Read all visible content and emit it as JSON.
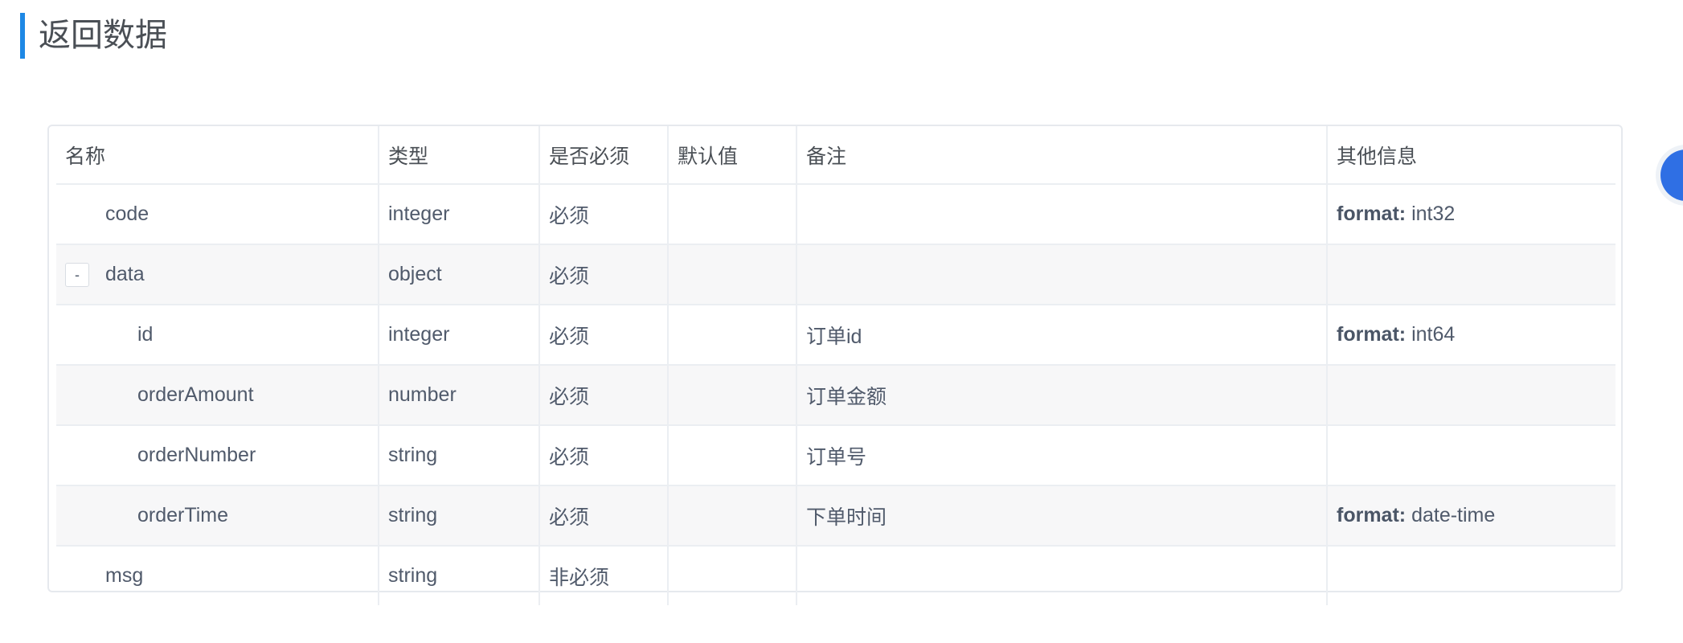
{
  "section": {
    "title": "返回数据"
  },
  "table": {
    "headers": [
      "名称",
      "类型",
      "是否必须",
      "默认值",
      "备注",
      "其他信息"
    ],
    "rows": [
      {
        "name": "code",
        "type": "integer",
        "required": "必须",
        "default": "",
        "remark": "",
        "other_key": "format:",
        "other_val": "int32"
      },
      {
        "name": "data",
        "toggle": "-",
        "type": "object",
        "required": "必须",
        "default": "",
        "remark": "",
        "other_key": "",
        "other_val": ""
      },
      {
        "name": "id",
        "type": "integer",
        "required": "必须",
        "default": "",
        "remark": "订单id",
        "other_key": "format:",
        "other_val": "int64"
      },
      {
        "name": "orderAmount",
        "type": "number",
        "required": "必须",
        "default": "",
        "remark": "订单金额",
        "other_key": "",
        "other_val": ""
      },
      {
        "name": "orderNumber",
        "type": "string",
        "required": "必须",
        "default": "",
        "remark": "订单号",
        "other_key": "",
        "other_val": ""
      },
      {
        "name": "orderTime",
        "type": "string",
        "required": "必须",
        "default": "",
        "remark": "下单时间",
        "other_key": "format:",
        "other_val": "date-time"
      },
      {
        "name": "msg",
        "type": "string",
        "required": "非必须",
        "default": "",
        "remark": "",
        "other_key": "",
        "other_val": ""
      }
    ]
  },
  "colors": {
    "accent": "#1e88e5",
    "side_button": "#2f6fe4"
  }
}
